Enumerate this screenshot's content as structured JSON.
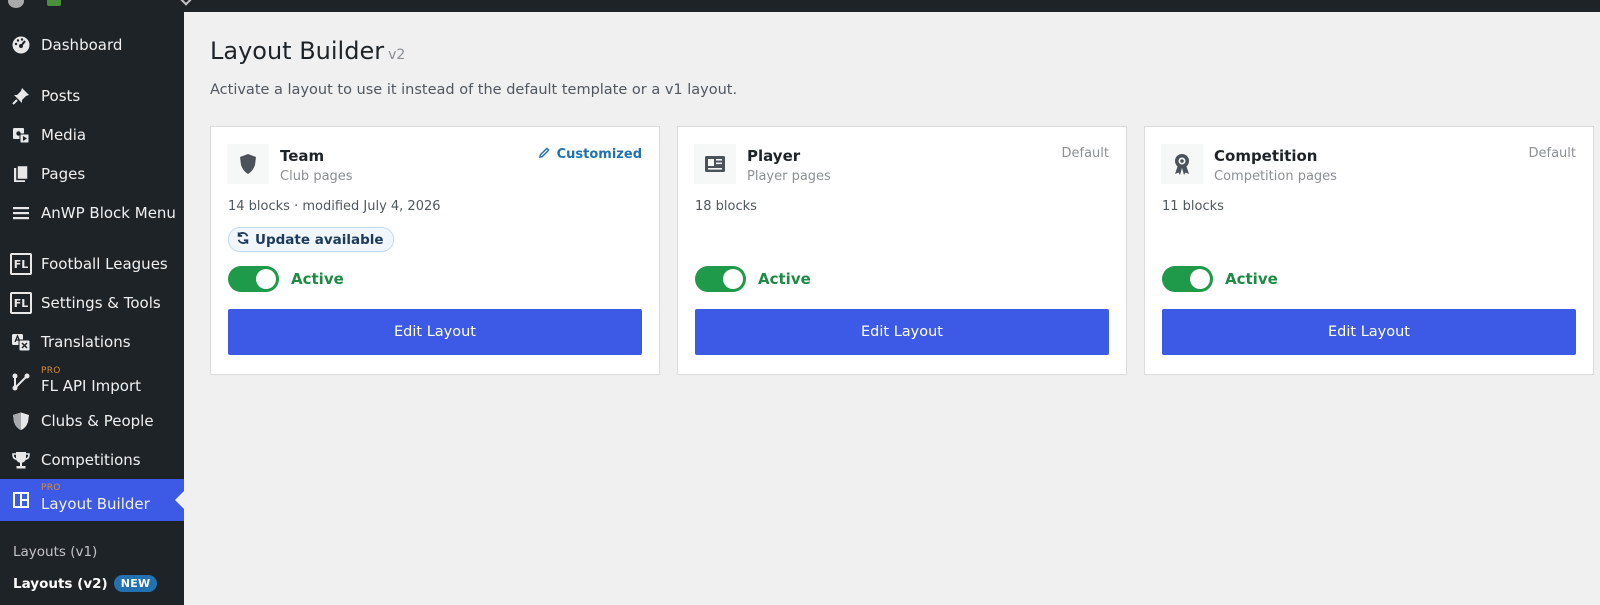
{
  "sidebar": {
    "items": [
      {
        "label": "Dashboard",
        "icon": "dashboard-icon"
      },
      {
        "label": "Posts",
        "icon": "pin-icon"
      },
      {
        "label": "Media",
        "icon": "media-icon"
      },
      {
        "label": "Pages",
        "icon": "pages-icon"
      },
      {
        "label": "AnWP Block Menu",
        "icon": "menu-lines-icon"
      },
      {
        "label": "Football Leagues",
        "icon": "fl-icon",
        "badge_text": "FL"
      },
      {
        "label": "Settings & Tools",
        "icon": "fl-icon",
        "badge_text": "FL"
      },
      {
        "label": "Translations",
        "icon": "translation-icon"
      },
      {
        "label": "FL API Import",
        "icon": "api-import-icon",
        "pro": "PRO"
      },
      {
        "label": "Clubs & People",
        "icon": "shield-icon"
      },
      {
        "label": "Competitions",
        "icon": "trophy-icon"
      },
      {
        "label": "Layout Builder",
        "icon": "layout-grid-icon",
        "pro": "PRO"
      }
    ],
    "submenu": [
      {
        "label": "Layouts (v1)"
      },
      {
        "label": "Layouts (v2)",
        "badge": "NEW"
      }
    ]
  },
  "page": {
    "title": "Layout Builder",
    "version": "v2",
    "description": "Activate a layout to use it instead of the default template or a v1 layout."
  },
  "cards": [
    {
      "title": "Team",
      "subtitle": "Club pages",
      "status": "Customized",
      "meta": "14 blocks · modified July 4, 2026",
      "update_label": "Update available",
      "toggle_label": "Active",
      "active": true,
      "button_label": "Edit Layout",
      "icon": "shield-icon"
    },
    {
      "title": "Player",
      "subtitle": "Player pages",
      "status": "Default",
      "meta": "18 blocks",
      "toggle_label": "Active",
      "active": true,
      "button_label": "Edit Layout",
      "icon": "id-card-icon"
    },
    {
      "title": "Competition",
      "subtitle": "Competition pages",
      "status": "Default",
      "meta": "11 blocks",
      "toggle_label": "Active",
      "active": true,
      "button_label": "Edit Layout",
      "icon": "award-icon"
    }
  ],
  "colors": {
    "sidebar_bg": "#1d2327",
    "accent": "#3c5ae6",
    "active_green": "#1e9a4a",
    "link_blue": "#2271b1"
  }
}
